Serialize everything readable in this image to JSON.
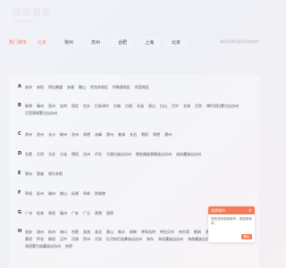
{
  "header": {
    "title": "网站管家",
    "subtitle": "www.wzgj.cc"
  },
  "citybar": {
    "hot_label": "热门城市",
    "hot": [
      "北京",
      "常州",
      "苏州",
      "合肥",
      "上海",
      "北京"
    ],
    "hint": "请您选择所要访问的城市"
  },
  "cities": [
    {
      "letter": "A",
      "names": [
        "安庆",
        "安阳",
        "阿拉善盟",
        "安顺",
        "鞍山",
        "阿克苏地区",
        "阿勒泰地区",
        "阿里地区"
      ]
    },
    {
      "letter": "B",
      "names": [
        "蚌埠",
        "亳州",
        "滨州",
        "宝鸡",
        "保定",
        "包头",
        "巴彦淖尔",
        "白城",
        "白银",
        "本溪",
        "保山",
        "白山",
        "巴中",
        "北海",
        "百色",
        "博尔塔拉蒙古自治州",
        "巴音郭楞蒙古自治州"
      ]
    },
    {
      "letter": "C",
      "names": [
        "常州",
        "池州",
        "长沙",
        "郴州",
        "沧州",
        "承德",
        "赤峰",
        "滁州",
        "巢湖",
        "长治",
        "朝阳",
        "常德",
        "潮州"
      ]
    },
    {
      "letter": "D",
      "names": [
        "东营",
        "大同",
        "大庆",
        "大连",
        "德阳",
        "达州",
        "丹东",
        "大理白族自治州",
        "德宏傣族景颇族自治州",
        "迪庆藏族自治州"
      ]
    },
    {
      "letter": "E",
      "names": [
        "鄂州",
        "恩施",
        "鄂尔多斯"
      ]
    },
    {
      "letter": "F",
      "names": [
        "阜阳",
        "抚州",
        "福州",
        "佛山",
        "抚顺",
        "阜新",
        "防城港"
      ]
    },
    {
      "letter": "G",
      "names": [
        "广州",
        "桂林",
        "贵阳",
        "赣州",
        "广安",
        "广元",
        "贵港",
        "固原"
      ]
    },
    {
      "letter": "H",
      "names": [
        "淮安",
        "湖州",
        "杭州",
        "海口",
        "合肥",
        "淮南",
        "淮北",
        "黄山",
        "衡水",
        "邯郸",
        "呼和浩特",
        "呼伦贝尔",
        "哈尔滨",
        "鹤岗",
        "黑河",
        "葫芦岛",
        "黄石",
        "黄冈",
        "怀化",
        "衡阳",
        "汉中",
        "河源",
        "贺州",
        "河池",
        "红河哈尼族彝族自治州",
        "海东",
        "海北藏族自治州",
        "海南藏族自治州",
        "黄南藏族自治州",
        "海西蒙古族藏族自治州",
        "哈密"
      ]
    }
  ],
  "popup": {
    "title": "选择城市",
    "close": "×",
    "text": "您还没有选择城市，请选择城市。",
    "confirm": "确定"
  },
  "colors": {
    "accent": "#f57c5a"
  }
}
